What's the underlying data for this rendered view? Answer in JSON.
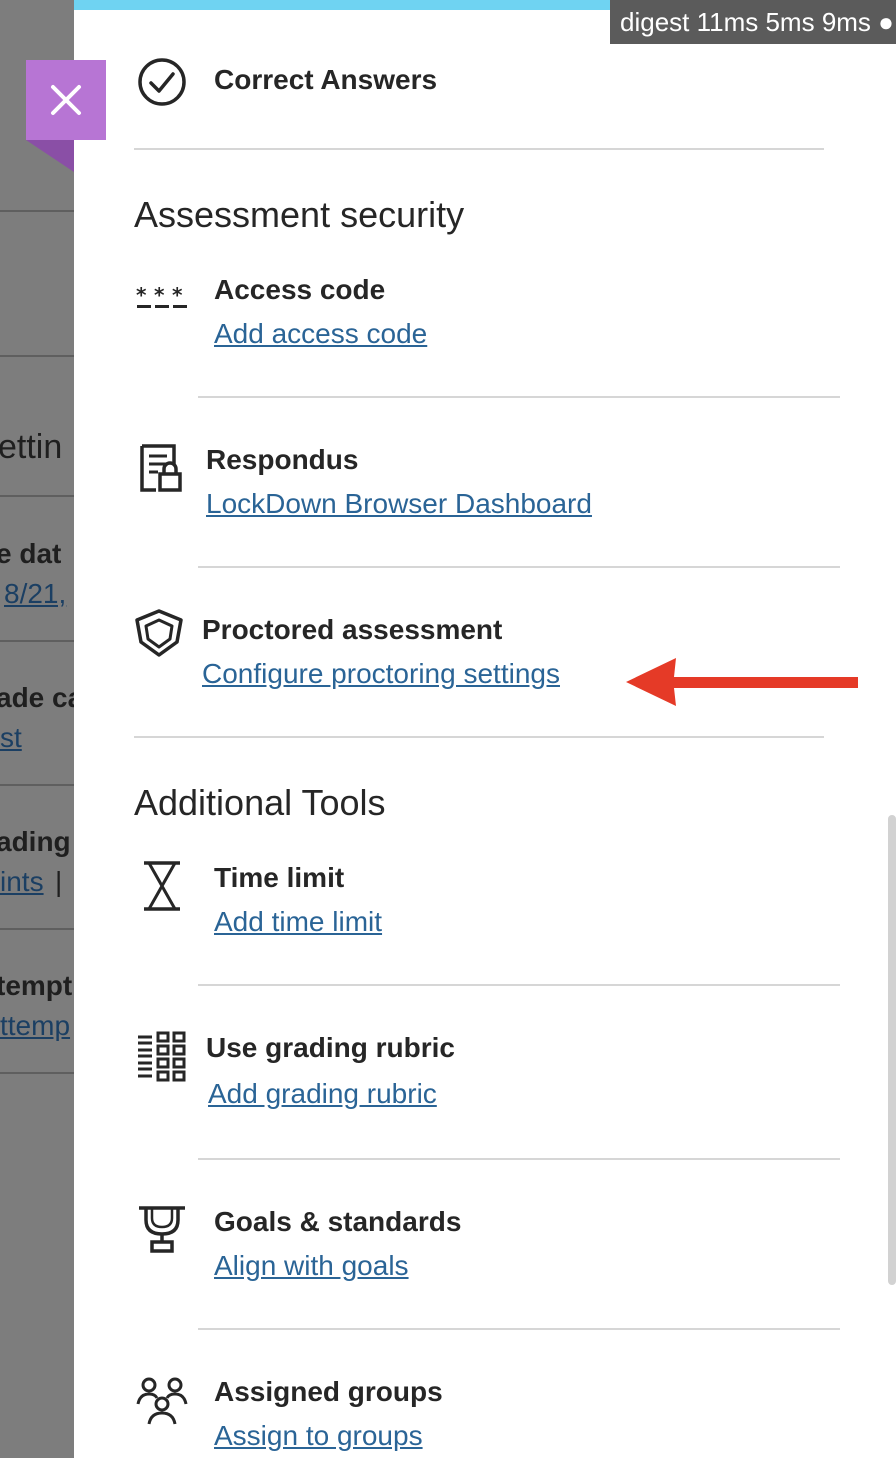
{
  "background": {
    "texts": [
      {
        "text": "ettin",
        "style": "bold"
      },
      {
        "text": "e dat",
        "style": "bold"
      },
      {
        "text": "8/21,",
        "style": "link"
      },
      {
        "text": "ade ca",
        "style": "bold"
      },
      {
        "text": "st",
        "style": "link"
      },
      {
        "text": "ading",
        "style": "bold"
      },
      {
        "text": "ints",
        "style": "link"
      },
      {
        "text": "|",
        "style": "plain"
      },
      {
        "text": "tempt",
        "style": "bold"
      },
      {
        "text": "ttemp",
        "style": "link"
      }
    ]
  },
  "perf_overlay": {
    "text": "digest 11ms 5ms 9ms ●"
  },
  "correct_answers": {
    "title": "Correct Answers",
    "icon": "check-circle-icon"
  },
  "assessment_security": {
    "heading": "Assessment security",
    "access_code": {
      "title": "Access code",
      "link": "Add access code",
      "icon": "asterisks-icon"
    },
    "respondus": {
      "title": "Respondus",
      "link": "LockDown Browser Dashboard",
      "icon": "locked-document-icon"
    },
    "proctored": {
      "title": "Proctored assessment",
      "link": "Configure proctoring settings",
      "icon": "shield-icon"
    }
  },
  "additional_tools": {
    "heading": "Additional Tools",
    "time_limit": {
      "title": "Time limit",
      "link": "Add time limit",
      "icon": "hourglass-icon"
    },
    "rubric": {
      "title": "Use grading rubric",
      "link": "Add grading rubric",
      "icon": "rubric-grid-icon"
    },
    "goals": {
      "title": "Goals & standards",
      "link": "Align with goals",
      "icon": "trophy-icon"
    },
    "groups": {
      "title": "Assigned groups",
      "link": "Assign to groups",
      "icon": "people-icon"
    }
  },
  "annotation": {
    "arrow_color": "#e53a27"
  },
  "colors": {
    "accent_close": "#b775d4",
    "link": "#2a6496",
    "top_bar": "#6fd3f2"
  }
}
